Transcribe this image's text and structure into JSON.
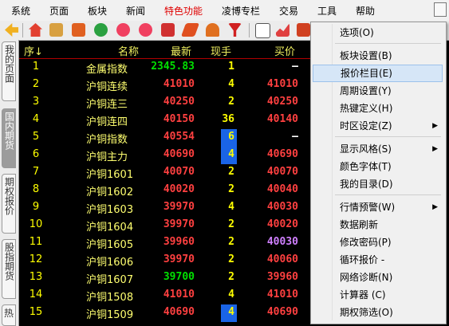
{
  "menubar": {
    "items": [
      "系统",
      "页面",
      "板块",
      "新闻",
      "特色功能",
      "凌博专栏",
      "交易",
      "工具",
      "帮助"
    ]
  },
  "sidebar": {
    "tabs": [
      "我的页面",
      "国内期货",
      "期权报价",
      "股指期货",
      "热"
    ]
  },
  "table": {
    "headers": {
      "no": "序↓",
      "name": "名称",
      "price": "最新",
      "vol": "现手",
      "bid": "买价"
    },
    "rows": [
      {
        "no": "1",
        "name": "金属指数",
        "price": "2345.83",
        "vol": "1",
        "bid": "—",
        "pc": "#00e000",
        "bc": "#ffffff",
        "vhl": false
      },
      {
        "no": "2",
        "name": "沪铜连续",
        "price": "41010",
        "vol": "4",
        "bid": "41010",
        "pc": "#ff4040",
        "bc": "#ff4040",
        "vhl": false
      },
      {
        "no": "3",
        "name": "沪铜连三",
        "price": "40250",
        "vol": "2",
        "bid": "40250",
        "pc": "#ff4040",
        "bc": "#ff4040",
        "vhl": false
      },
      {
        "no": "4",
        "name": "沪铜连四",
        "price": "40150",
        "vol": "36",
        "bid": "40140",
        "pc": "#ff4040",
        "bc": "#ff4040",
        "vhl": false
      },
      {
        "no": "5",
        "name": "沪铜指数",
        "price": "40554",
        "vol": "6",
        "bid": "—",
        "pc": "#ff4040",
        "bc": "#ffffff",
        "vhl": true
      },
      {
        "no": "6",
        "name": "沪铜主力",
        "price": "40690",
        "vol": "4",
        "bid": "40690",
        "pc": "#ff4040",
        "bc": "#ff4040",
        "vhl": true
      },
      {
        "no": "7",
        "name": "沪铜1601",
        "price": "40070",
        "vol": "2",
        "bid": "40070",
        "pc": "#ff4040",
        "bc": "#ff4040",
        "vhl": false
      },
      {
        "no": "8",
        "name": "沪铜1602",
        "price": "40020",
        "vol": "2",
        "bid": "40040",
        "pc": "#ff4040",
        "bc": "#ff4040",
        "vhl": false
      },
      {
        "no": "9",
        "name": "沪铜1603",
        "price": "39970",
        "vol": "4",
        "bid": "40030",
        "pc": "#ff4040",
        "bc": "#ff4040",
        "vhl": false
      },
      {
        "no": "10",
        "name": "沪铜1604",
        "price": "39970",
        "vol": "2",
        "bid": "40020",
        "pc": "#ff4040",
        "bc": "#ff4040",
        "vhl": false
      },
      {
        "no": "11",
        "name": "沪铜1605",
        "price": "39960",
        "vol": "2",
        "bid": "40030",
        "pc": "#ff4040",
        "bc": "#d080ff",
        "vhl": false
      },
      {
        "no": "12",
        "name": "沪铜1606",
        "price": "39970",
        "vol": "2",
        "bid": "40060",
        "pc": "#ff4040",
        "bc": "#ff4040",
        "vhl": false
      },
      {
        "no": "13",
        "name": "沪铜1607",
        "price": "39700",
        "vol": "2",
        "bid": "39960",
        "pc": "#00e000",
        "bc": "#ff4040",
        "vhl": false
      },
      {
        "no": "14",
        "name": "沪铜1508",
        "price": "41010",
        "vol": "4",
        "bid": "41010",
        "pc": "#ff4040",
        "bc": "#ff4040",
        "vhl": false
      },
      {
        "no": "15",
        "name": "沪铜1509",
        "price": "40690",
        "vol": "4",
        "bid": "40690",
        "pc": "#ff4040",
        "bc": "#ff4040",
        "vhl": true
      }
    ]
  },
  "context_menu": {
    "items": [
      {
        "label": "选项(O)",
        "arrow": ""
      },
      {
        "label": "板块设置(B)",
        "arrow": ""
      },
      {
        "label": "报价栏目(E)",
        "arrow": "",
        "highlight": true
      },
      {
        "label": "周期设置(Y)",
        "arrow": ""
      },
      {
        "label": "热键定义(H)",
        "arrow": ""
      },
      {
        "label": "时区设定(Z)",
        "arrow": "▶"
      },
      {
        "label": "显示风格(S)",
        "arrow": "▶"
      },
      {
        "label": "颜色字体(T)",
        "arrow": ""
      },
      {
        "label": "我的目录(D)",
        "arrow": ""
      },
      {
        "label": "行情预警(W)",
        "arrow": "▶"
      },
      {
        "label": "数据刷新",
        "arrow": ""
      },
      {
        "label": "修改密码(P)",
        "arrow": ""
      },
      {
        "label": "循环报价    -",
        "arrow": ""
      },
      {
        "label": "网络诊断(N)",
        "arrow": ""
      },
      {
        "label": "计算器   (C)",
        "arrow": ""
      },
      {
        "label": "期权筛选(O)",
        "arrow": ""
      }
    ]
  },
  "colors": {
    "header": "#f0f060",
    "up": "#ff4040",
    "down": "#00e000",
    "volume_highlight": "#1a64e6"
  }
}
